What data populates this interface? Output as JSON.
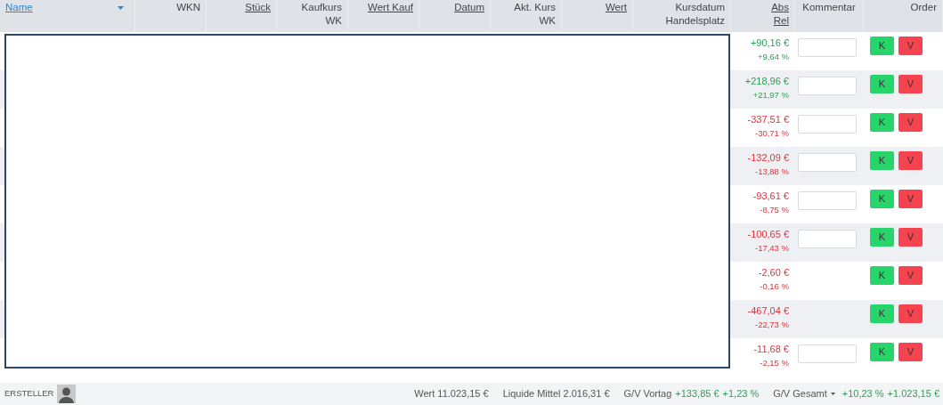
{
  "columns": [
    {
      "lines": [
        "Name"
      ],
      "sortable": true,
      "selected": true
    },
    {
      "lines": [
        "WKN"
      ],
      "sortable": false,
      "selected": false
    },
    {
      "lines": [
        "Stück"
      ],
      "sortable": true,
      "selected": false
    },
    {
      "lines": [
        "Kaufkurs",
        "WK"
      ],
      "sortable": false,
      "selected": false
    },
    {
      "lines": [
        "Wert Kauf"
      ],
      "sortable": true,
      "selected": false
    },
    {
      "lines": [
        "Datum"
      ],
      "sortable": true,
      "selected": false
    },
    {
      "lines": [
        "Akt. Kurs",
        "WK"
      ],
      "sortable": false,
      "selected": false
    },
    {
      "lines": [
        "Wert"
      ],
      "sortable": true,
      "selected": false
    },
    {
      "lines": [
        "Kursdatum",
        "Handelsplatz"
      ],
      "sortable": false,
      "selected": false
    },
    {
      "lines": [
        "Abs",
        "Rel"
      ],
      "sortable": true,
      "selected": false
    },
    {
      "lines": [
        "Kommentar"
      ],
      "sortable": false,
      "selected": false
    },
    {
      "lines": [
        "Order"
      ],
      "sortable": false,
      "selected": false
    }
  ],
  "rows": [
    {
      "abs": "+90,16 €",
      "rel": "+9,64 %",
      "kind": "gain",
      "comment_field": true,
      "buy": "K",
      "sell": "V"
    },
    {
      "abs": "+218,96 €",
      "rel": "+21,97 %",
      "kind": "gain",
      "comment_field": true,
      "buy": "K",
      "sell": "V"
    },
    {
      "abs": "-337,51 €",
      "rel": "-30,71 %",
      "kind": "loss",
      "comment_field": true,
      "buy": "K",
      "sell": "V"
    },
    {
      "abs": "-132,09 €",
      "rel": "-13,88 %",
      "kind": "loss",
      "comment_field": true,
      "buy": "K",
      "sell": "V"
    },
    {
      "abs": "-93,61 €",
      "rel": "-8,75 %",
      "kind": "loss",
      "comment_field": true,
      "buy": "K",
      "sell": "V"
    },
    {
      "abs": "-100,65 €",
      "rel": "-17,43 %",
      "kind": "loss",
      "comment_field": true,
      "buy": "K",
      "sell": "V"
    },
    {
      "abs": "-2,60 €",
      "rel": "-0,16 %",
      "kind": "loss",
      "comment_field": false,
      "buy": "K",
      "sell": "V"
    },
    {
      "abs": "-467,04 €",
      "rel": "-22,73 %",
      "kind": "loss",
      "comment_field": false,
      "buy": "K",
      "sell": "V"
    },
    {
      "abs": "-11,68 €",
      "rel": "-2,15 %",
      "kind": "loss",
      "comment_field": true,
      "buy": "K",
      "sell": "V"
    }
  ],
  "footer": {
    "creator": "ERSTELLER",
    "wert": "Wert 11.023,15 €",
    "liquid": "Liquide Mittel 2.016,31 €",
    "vortag_label": "G/V Vortag",
    "vortag_abs": "+133,85 €",
    "vortag_rel": "+1,23 %",
    "gesamt_label": "G/V Gesamt",
    "gesamt_rel": "+10,23 %",
    "gesamt_abs": "+1.023,15 €"
  }
}
